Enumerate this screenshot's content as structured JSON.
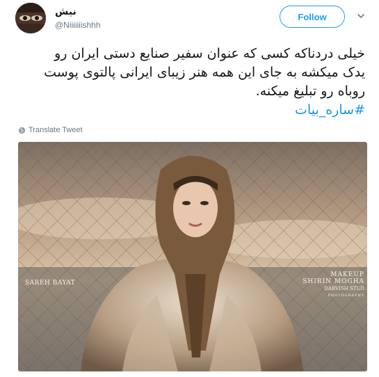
{
  "tweet": {
    "author": {
      "display_name": "نیش",
      "handle": "@Niiiiiiishhh"
    },
    "follow_label": "Follow",
    "text_lines": [
      "خیلی دردناکه کسی که عنوان سفیر صنایع دستی ایران رو",
      "یدک میکشه به جای این همه هنر زیبای ایرانی پالتوی پوست",
      "روباه رو تبلیغ میکنه."
    ],
    "hashtag": "#ساره_بیات",
    "translate_label": "Translate Tweet",
    "media": {
      "watermark_left": "SAREH BAYAT",
      "watermark_right_1": "MAKEUP",
      "watermark_right_2": "SHIRIN MOGHA",
      "watermark_right_3": "DARVISH STUD",
      "watermark_right_4": "PHOTOGRAPHY"
    }
  },
  "colors": {
    "accent": "#1da1f2",
    "hashtag": "#1b95e0",
    "secondary_text": "#657786"
  },
  "icons": {
    "translate": "globe-icon",
    "menu": "chevron-down-icon"
  }
}
